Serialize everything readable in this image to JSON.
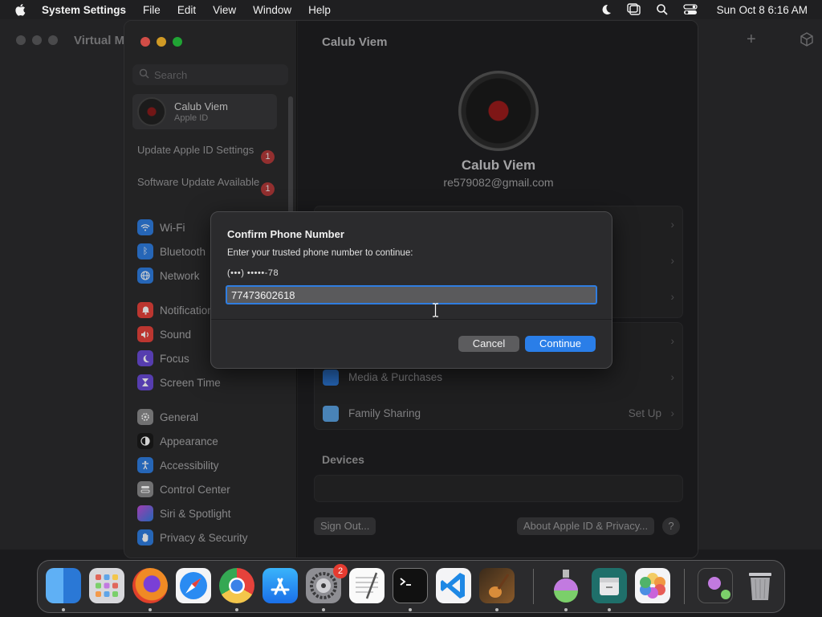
{
  "menubar": {
    "app_name": "System Settings",
    "menus": [
      "File",
      "Edit",
      "View",
      "Window",
      "Help"
    ],
    "clock": "Sun Oct 8  6:16 AM"
  },
  "background_window": {
    "title": "Virtual M"
  },
  "settings": {
    "search_placeholder": "Search",
    "account": {
      "name": "Calub Viem",
      "subtitle": "Apple ID"
    },
    "notices": [
      {
        "label": "Update Apple ID Settings",
        "badge": "1"
      },
      {
        "label": "Software Update Available",
        "badge": "1"
      }
    ],
    "sidebar_items": [
      {
        "label": "Wi-Fi",
        "color": "#2f7de0"
      },
      {
        "label": "Bluetooth",
        "color": "#2f7de0"
      },
      {
        "label": "Network",
        "color": "#2f7de0"
      },
      {
        "label": "Notifications",
        "color": "#e5423b"
      },
      {
        "label": "Sound",
        "color": "#e5423b"
      },
      {
        "label": "Focus",
        "color": "#6a4bd6"
      },
      {
        "label": "Screen Time",
        "color": "#6a4bd6"
      },
      {
        "label": "General",
        "color": "#8a8a8c"
      },
      {
        "label": "Appearance",
        "color": "#1a1a1a"
      },
      {
        "label": "Accessibility",
        "color": "#2f7de0"
      },
      {
        "label": "Control Center",
        "color": "#8a8a8c"
      },
      {
        "label": "Siri & Spotlight",
        "color": "#c24bd6"
      },
      {
        "label": "Privacy & Security",
        "color": "#2f7de0"
      }
    ],
    "page_title": "Calub Viem",
    "profile": {
      "name": "Calub Viem",
      "email": "re579082@gmail.com"
    },
    "rows": [
      {
        "label": "Media & Purchases",
        "value": ""
      },
      {
        "label": "Family Sharing",
        "value": "Set Up"
      }
    ],
    "devices_header": "Devices",
    "sign_out": "Sign Out...",
    "about": "About Apple ID & Privacy...",
    "help": "?"
  },
  "dialog": {
    "title": "Confirm Phone Number",
    "message": "Enter your trusted phone number to continue:",
    "masked_number": "(•••) •••••-78",
    "input_value": "77473602618",
    "cancel": "Cancel",
    "continue": "Continue"
  },
  "dock": {
    "settings_badge": "2",
    "apps": [
      "Finder",
      "Launchpad",
      "Firefox",
      "Safari",
      "Chrome",
      "App Store",
      "System Settings",
      "TextEdit",
      "Terminal",
      "Visual Studio Code",
      "GarageBand",
      "Xcode Simulator",
      "Archive",
      "Photos",
      "Downloads",
      "Trash"
    ]
  }
}
